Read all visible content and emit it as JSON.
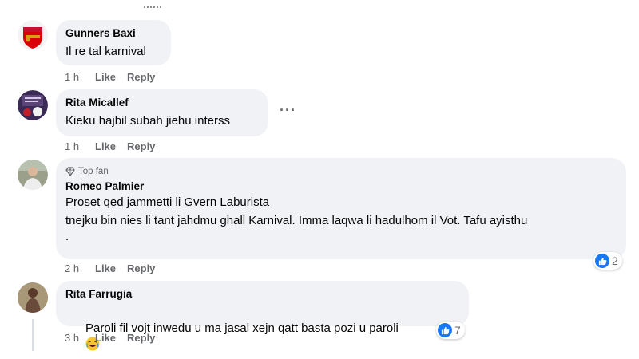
{
  "comments": [
    {
      "author": "Gunners Baxi",
      "text": "Il re tal karnival",
      "time": "1 h",
      "like": "Like",
      "reply": "Reply"
    },
    {
      "author": "Rita Micallef",
      "text": "Kieku hajbil subah jiehu interss",
      "time": "1 h",
      "like": "Like",
      "reply": "Reply"
    },
    {
      "badge": "Top fan",
      "author": "Romeo Palmier",
      "text_lines": [
        "Proset qed jammetti li Gvern Laburista",
        "tnejku bin nies li tant jahdmu ghall Karnival. Imma laqwa li hadulhom il Vot. Tafu ayisthu",
        "."
      ],
      "time": "2 h",
      "like": "Like",
      "reply": "Reply",
      "reaction_count": "2"
    },
    {
      "author": "Rita Farrugia",
      "text": "Paroli fil vojt inwedu u ma jasal xejn qatt basta pozi u paroli",
      "time": "3 h",
      "like": "Like",
      "reply": "Reply",
      "reaction_count": "7"
    }
  ],
  "icons": {
    "more": "more-options-icon",
    "like": "like-reaction-icon",
    "topfan": "diamond-badge-icon",
    "emoji": "laughing-emoji-icon"
  },
  "colors": {
    "accent": "#1877f2",
    "bubble": "#f0f2f5",
    "muted": "#65676b"
  }
}
